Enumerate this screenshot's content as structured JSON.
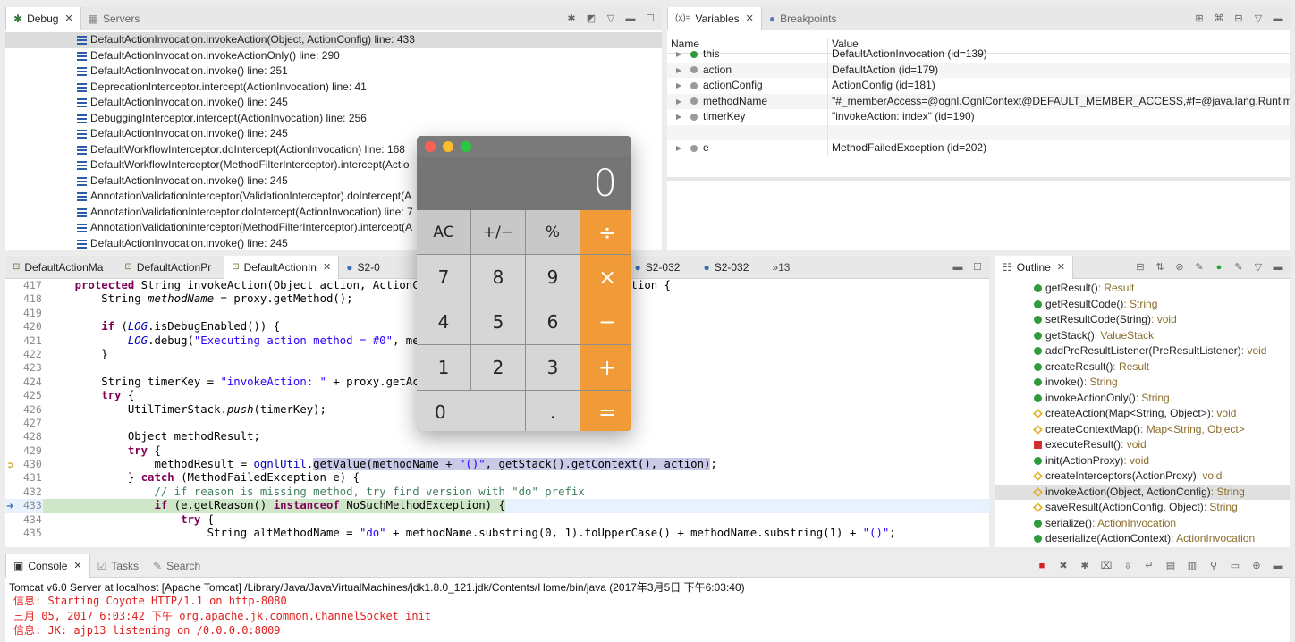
{
  "debug": {
    "tabs": [
      {
        "label": "Debug"
      },
      {
        "label": "Servers"
      }
    ],
    "frames": [
      "DefaultActionInvocation.invokeAction(Object, ActionConfig) line: 433",
      "DefaultActionInvocation.invokeActionOnly() line: 290",
      "DefaultActionInvocation.invoke() line: 251",
      "DeprecationInterceptor.intercept(ActionInvocation) line: 41",
      "DefaultActionInvocation.invoke() line: 245",
      "DebuggingInterceptor.intercept(ActionInvocation) line: 256",
      "DefaultActionInvocation.invoke() line: 245",
      "DefaultWorkflowInterceptor.doIntercept(ActionInvocation) line: 168",
      "DefaultWorkflowInterceptor(MethodFilterInterceptor).intercept(Actio",
      "DefaultActionInvocation.invoke() line: 245",
      "AnnotationValidationInterceptor(ValidationInterceptor).doIntercept(A",
      "AnnotationValidationInterceptor.doIntercept(ActionInvocation) line: 7",
      "AnnotationValidationInterceptor(MethodFilterInterceptor).intercept(A",
      "DefaultActionInvocation.invoke() line: 245"
    ]
  },
  "variables": {
    "tabs": [
      {
        "label": "Variables"
      },
      {
        "label": "Breakpoints"
      }
    ],
    "tab_prefix": "(x)=",
    "col_name": "Name",
    "col_value": "Value",
    "rows": [
      {
        "name": "this",
        "value": "DefaultActionInvocation  (id=139)",
        "dot": "#2e9c3a"
      },
      {
        "name": "action",
        "value": "DefaultAction  (id=179)",
        "dot": "#9a9a9a"
      },
      {
        "name": "actionConfig",
        "value": "ActionConfig  (id=181)",
        "dot": "#9a9a9a"
      },
      {
        "name": "methodName",
        "value": "\"#_memberAccess=@ognl.OgnlContext@DEFAULT_MEMBER_ACCESS,#f=@java.lang.Runtim...",
        "dot": "#9a9a9a"
      },
      {
        "name": "timerKey",
        "value": "\"invokeAction: index\" (id=190)",
        "dot": "#9a9a9a"
      },
      {
        "name": "",
        "value": "",
        "dot": ""
      },
      {
        "name": "e",
        "value": "MethodFailedException  (id=202)",
        "dot": "#9a9a9a"
      }
    ]
  },
  "editor": {
    "tabs": [
      "DefaultActionMa",
      "DefaultActionPr",
      "DefaultActionIn",
      "S2-0",
      "2",
      "S2-032",
      "S2-032"
    ],
    "overflow": "»13",
    "lines": [
      {
        "n": "417",
        "html": "    <span class='kw'>protected</span> String invokeAction(Object action, ActionConfig actionConfig) <span class='kw'>throws</span> Exception {"
      },
      {
        "n": "418",
        "html": "        String <i>methodName</i> = proxy.getMethod();"
      },
      {
        "n": "419",
        "html": ""
      },
      {
        "n": "420",
        "html": "        <span class='kw'>if</span> (<span class='fld'>LOG</span>.isDebugEnabled()) {"
      },
      {
        "n": "421",
        "html": "            <span class='fld'>LOG</span>.debug(<span class='str'>\"Executing action method = #0\"</span>, methodName);"
      },
      {
        "n": "422",
        "html": "        }"
      },
      {
        "n": "423",
        "html": ""
      },
      {
        "n": "424",
        "html": "        String timerKey = <span class='str'>\"invokeAction: \"</span> + proxy.getActionName();"
      },
      {
        "n": "425",
        "html": "        <span class='kw'>try</span> {"
      },
      {
        "n": "426",
        "html": "            UtilTimerStack.<i>push</i>(timerKey);"
      },
      {
        "n": "427",
        "html": ""
      },
      {
        "n": "428",
        "html": "            Object methodResult;"
      },
      {
        "n": "429",
        "html": "            <span class='kw'>try</span> {"
      },
      {
        "n": "430",
        "html": "                methodResult = <span class='fld' style='font-style:normal'>ognlUtil</span>.<span class='sel-expr'>getValue(methodName + <span class='str'>\"()\"</span>, getStack().getContext(), action)</span>;"
      },
      {
        "n": "431",
        "html": "            } <span class='kw'>catch</span> (MethodFailedException e) {"
      },
      {
        "n": "432",
        "html": "                <span class='cmt'>// if reason is missing method, try find version with \"do\" prefix</span>"
      },
      {
        "n": "433",
        "html": "                <span class='kw'>if</span> (e.getReason() <span class='kw'>instanceof</span> NoSuchMethodException) {"
      },
      {
        "n": "434",
        "html": "                    <span class='kw'>try</span> {"
      },
      {
        "n": "435",
        "html": "                        String altMethodName = <span class='str'>\"do\"</span> + methodName.substring(0, 1).toUpperCase() + methodName.substring(1) + <span class='str'>\"()\"</span>;"
      }
    ]
  },
  "outline": {
    "tab": "Outline",
    "items": [
      {
        "name": "getResult()",
        "type": " : Result",
        "vis": "public"
      },
      {
        "name": "getResultCode()",
        "type": " : String",
        "vis": "public"
      },
      {
        "name": "setResultCode(String)",
        "type": " : void",
        "vis": "public"
      },
      {
        "name": "getStack()",
        "type": " : ValueStack",
        "vis": "public"
      },
      {
        "name": "addPreResultListener(PreResultListener)",
        "type": " : void",
        "vis": "public"
      },
      {
        "name": "createResult()",
        "type": " : Result",
        "vis": "public"
      },
      {
        "name": "invoke()",
        "type": " : String",
        "vis": "public"
      },
      {
        "name": "invokeActionOnly()",
        "type": " : String",
        "vis": "public"
      },
      {
        "name": "createAction(Map<String, Object>)",
        "type": " : void",
        "vis": "protected"
      },
      {
        "name": "createContextMap()",
        "type": " : Map<String, Object>",
        "vis": "protected"
      },
      {
        "name": "executeResult()",
        "type": " : void",
        "vis": "private"
      },
      {
        "name": "init(ActionProxy)",
        "type": " : void",
        "vis": "public"
      },
      {
        "name": "createInterceptors(ActionProxy)",
        "type": " : void",
        "vis": "protected"
      },
      {
        "name": "invokeAction(Object, ActionConfig)",
        "type": " : String",
        "vis": "protected"
      },
      {
        "name": "saveResult(ActionConfig, Object)",
        "type": " : String",
        "vis": "protected"
      },
      {
        "name": "serialize()",
        "type": " : ActionInvocation",
        "vis": "public"
      },
      {
        "name": "deserialize(ActionContext)",
        "type": " : ActionInvocation",
        "vis": "public"
      }
    ]
  },
  "console": {
    "tabs": [
      "Console",
      "Tasks",
      "Search"
    ],
    "header": "Tomcat v6.0 Server at localhost [Apache Tomcat] /Library/Java/JavaVirtualMachines/jdk1.8.0_121.jdk/Contents/Home/bin/java (2017年3月5日 下午6:03:40)",
    "lines": [
      "信息: Starting Coyote HTTP/1.1 on http-8080",
      "三月 05, 2017 6:03:42 下午 org.apache.jk.common.ChannelSocket init",
      "信息: JK: ajp13 listening on /0.0.0.0:8009"
    ]
  },
  "calculator": {
    "display": "0",
    "keys": [
      {
        "label": "AC",
        "kind": "top"
      },
      {
        "label": "+/−",
        "kind": "top"
      },
      {
        "label": "%",
        "kind": "top"
      },
      {
        "label": "÷",
        "kind": "op"
      },
      {
        "label": "7",
        "kind": "num"
      },
      {
        "label": "8",
        "kind": "num"
      },
      {
        "label": "9",
        "kind": "num"
      },
      {
        "label": "×",
        "kind": "op"
      },
      {
        "label": "4",
        "kind": "num"
      },
      {
        "label": "5",
        "kind": "num"
      },
      {
        "label": "6",
        "kind": "num"
      },
      {
        "label": "−",
        "kind": "op"
      },
      {
        "label": "1",
        "kind": "num"
      },
      {
        "label": "2",
        "kind": "num"
      },
      {
        "label": "3",
        "kind": "num"
      },
      {
        "label": "+",
        "kind": "op"
      },
      {
        "label": "0",
        "kind": "zero"
      },
      {
        "label": ".",
        "kind": "num"
      },
      {
        "label": "=",
        "kind": "op"
      }
    ]
  }
}
